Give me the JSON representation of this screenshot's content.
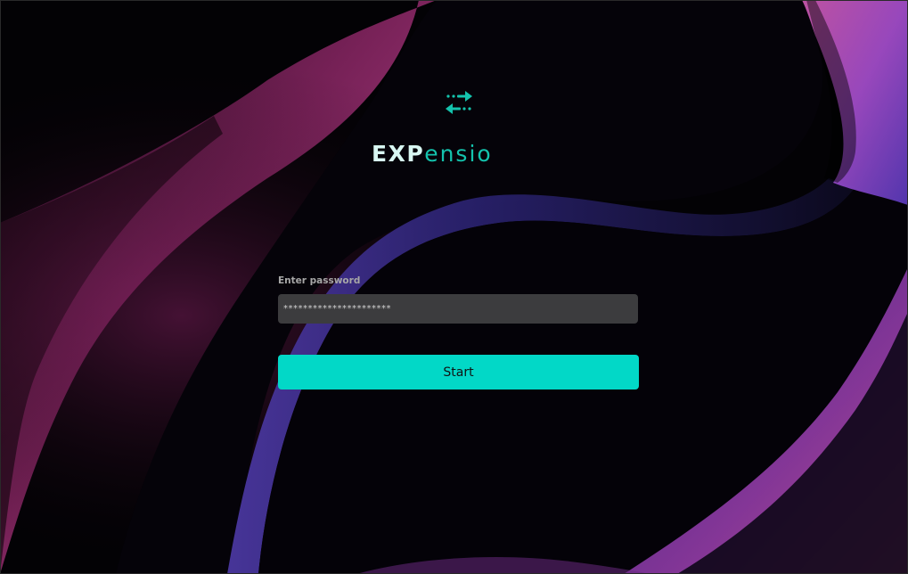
{
  "brand": {
    "name_part_1": "EXP",
    "name_part_2": "ensio",
    "logo_icon": "swap-arrows-icon",
    "accent_color": "#14c3ad"
  },
  "login": {
    "password_label": "Enter password",
    "password_value": "**********************",
    "submit_label": "Start",
    "button_color": "#02d8c7"
  },
  "background": {
    "style": "dark abstract waves",
    "colors": [
      "#030205",
      "#b3307a",
      "#5a4ad0",
      "#d15bb0"
    ]
  }
}
